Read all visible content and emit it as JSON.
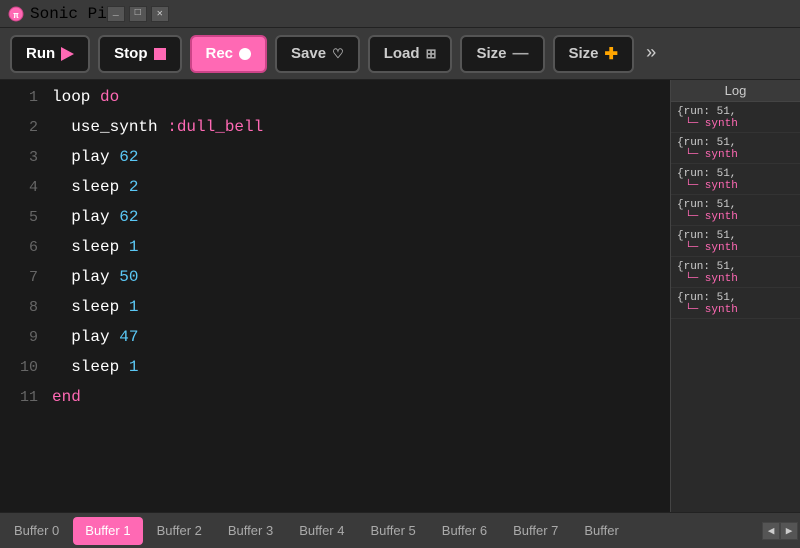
{
  "titlebar": {
    "title": "Sonic Pi",
    "controls": [
      "minimize",
      "maximize",
      "close"
    ]
  },
  "toolbar": {
    "run_label": "Run",
    "stop_label": "Stop",
    "rec_label": "Rec",
    "save_label": "Save",
    "load_label": "Load",
    "size_minus_label": "Size",
    "size_plus_label": "Size",
    "more_label": "»"
  },
  "editor": {
    "lines": [
      {
        "num": "1",
        "tokens": [
          {
            "text": "loop ",
            "class": "kw-loop"
          },
          {
            "text": "do",
            "class": "kw-do"
          }
        ]
      },
      {
        "num": "2",
        "tokens": [
          {
            "text": "  use_synth ",
            "class": "kw-use_synth"
          },
          {
            "text": ":dull_bell",
            "class": "sym-dull_bell"
          }
        ]
      },
      {
        "num": "3",
        "tokens": [
          {
            "text": "  play ",
            "class": "kw-play"
          },
          {
            "text": "62",
            "class": "num"
          }
        ]
      },
      {
        "num": "4",
        "tokens": [
          {
            "text": "  sleep ",
            "class": "kw-sleep"
          },
          {
            "text": "2",
            "class": "num"
          }
        ]
      },
      {
        "num": "5",
        "tokens": [
          {
            "text": "  play ",
            "class": "kw-play"
          },
          {
            "text": "62",
            "class": "num"
          }
        ]
      },
      {
        "num": "6",
        "tokens": [
          {
            "text": "  sleep ",
            "class": "kw-sleep"
          },
          {
            "text": "1",
            "class": "num"
          }
        ]
      },
      {
        "num": "7",
        "tokens": [
          {
            "text": "  play ",
            "class": "kw-play"
          },
          {
            "text": "50",
            "class": "num"
          }
        ]
      },
      {
        "num": "8",
        "tokens": [
          {
            "text": "  sleep ",
            "class": "kw-sleep"
          },
          {
            "text": "1",
            "class": "num"
          }
        ]
      },
      {
        "num": "9",
        "tokens": [
          {
            "text": "  play ",
            "class": "kw-play"
          },
          {
            "text": "47",
            "class": "num"
          }
        ]
      },
      {
        "num": "10",
        "tokens": [
          {
            "text": "  sleep ",
            "class": "kw-sleep"
          },
          {
            "text": "1",
            "class": "num"
          }
        ]
      },
      {
        "num": "11",
        "tokens": [
          {
            "text": "end",
            "class": "kw-end"
          }
        ]
      }
    ]
  },
  "log": {
    "header": "Log",
    "entries": [
      {
        "run": "{run: 51,",
        "synth": "└─ synth"
      },
      {
        "run": "{run: 51,",
        "synth": "└─ synth"
      },
      {
        "run": "{run: 51,",
        "synth": "└─ synth"
      },
      {
        "run": "{run: 51,",
        "synth": "└─ synth"
      },
      {
        "run": "{run: 51,",
        "synth": "└─ synth"
      },
      {
        "run": "{run: 51,",
        "synth": "└─ synth"
      },
      {
        "run": "{run: 51,",
        "synth": "└─ synth"
      }
    ]
  },
  "tabs": {
    "items": [
      "Buffer 0",
      "Buffer 1",
      "Buffer 2",
      "Buffer 3",
      "Buffer 4",
      "Buffer 5",
      "Buffer 6",
      "Buffer 7",
      "Buffer"
    ],
    "active_index": 1,
    "nav_prev": "◀",
    "nav_next": "▶"
  }
}
